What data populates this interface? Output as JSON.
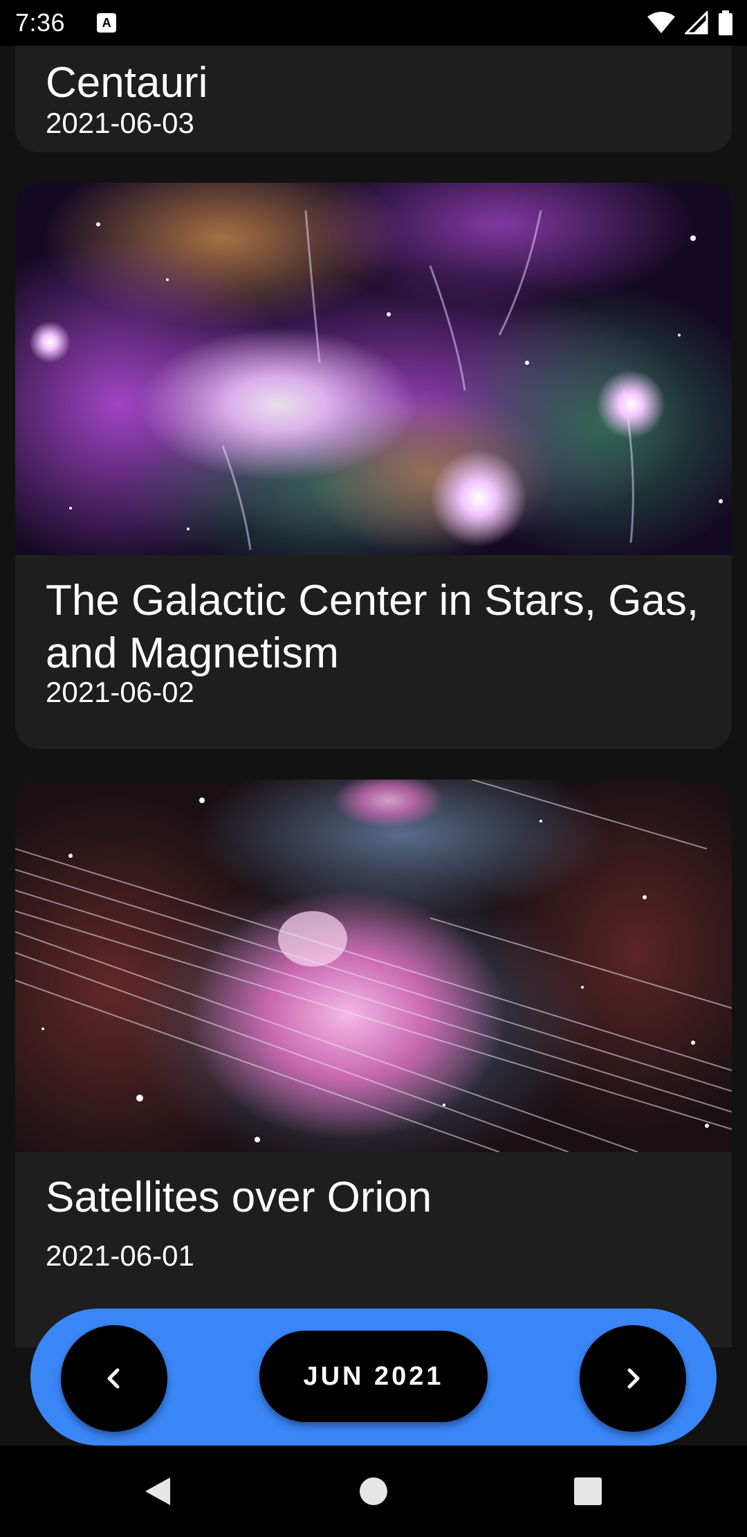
{
  "status_bar": {
    "time": "7:36",
    "notification_icon": "a-keyboard-icon",
    "icons": [
      "wifi-icon",
      "signal-icon",
      "battery-icon"
    ]
  },
  "cards": [
    {
      "title": "Centauri",
      "date": "2021-06-03",
      "image": "partial-card-no-image"
    },
    {
      "title": "The Galactic Center in Stars, Gas, and Magnetism",
      "date": "2021-06-02",
      "image": "galactic-center-nebula-image"
    },
    {
      "title": "Satellites over Orion",
      "date": "2021-06-01",
      "image": "orion-nebula-satellite-trails-image"
    }
  ],
  "pager": {
    "prev_icon": "chevron-left-icon",
    "month_label": "JUN 2021",
    "next_icon": "chevron-right-icon",
    "bar_color": "#3a86f6"
  },
  "nav_bar": {
    "icons": [
      "back-triangle-icon",
      "home-circle-icon",
      "recents-square-icon"
    ]
  }
}
